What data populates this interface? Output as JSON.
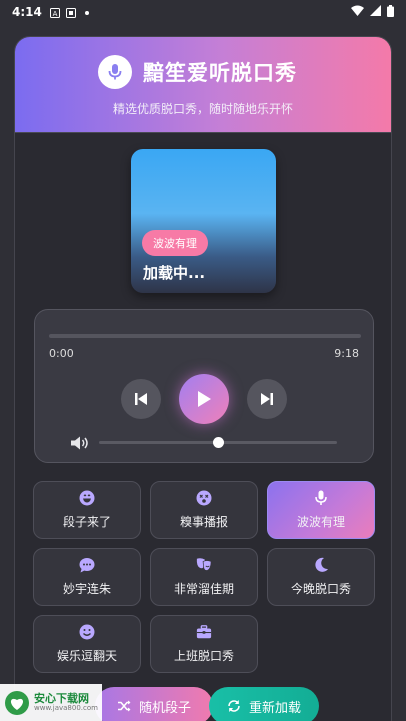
{
  "statusbar": {
    "time": "4:14"
  },
  "header": {
    "title": "黯笙爱听脱口秀",
    "subtitle": "精选优质脱口秀，随时随地乐开怀"
  },
  "cover": {
    "badge": "波波有理",
    "status": "加载中..."
  },
  "player": {
    "current_time": "0:00",
    "total_time": "9:18",
    "progress": 0,
    "volume": 0.5
  },
  "categories": [
    {
      "label": "段子来了",
      "icon": "laugh-icon",
      "active": false
    },
    {
      "label": "糗事播报",
      "icon": "dizzy-face-icon",
      "active": false
    },
    {
      "label": "波波有理",
      "icon": "microphone-icon",
      "active": true
    },
    {
      "label": "妙宇连朱",
      "icon": "comment-dots-icon",
      "active": false
    },
    {
      "label": "非常溜佳期",
      "icon": "theater-masks-icon",
      "active": false
    },
    {
      "label": "今晚脱口秀",
      "icon": "moon-icon",
      "active": false
    },
    {
      "label": "娱乐逗翻天",
      "icon": "smile-icon",
      "active": false
    },
    {
      "label": "上班脱口秀",
      "icon": "briefcase-icon",
      "active": false
    }
  ],
  "actions": {
    "random_label": "随机段子",
    "reload_label": "重新加载"
  },
  "watermark": {
    "main": "安心下载网",
    "sub": "www.java800.com"
  },
  "colors": {
    "accent": "#8a7ff0",
    "pink": "#f47aa9",
    "teal": "#15b69e"
  }
}
